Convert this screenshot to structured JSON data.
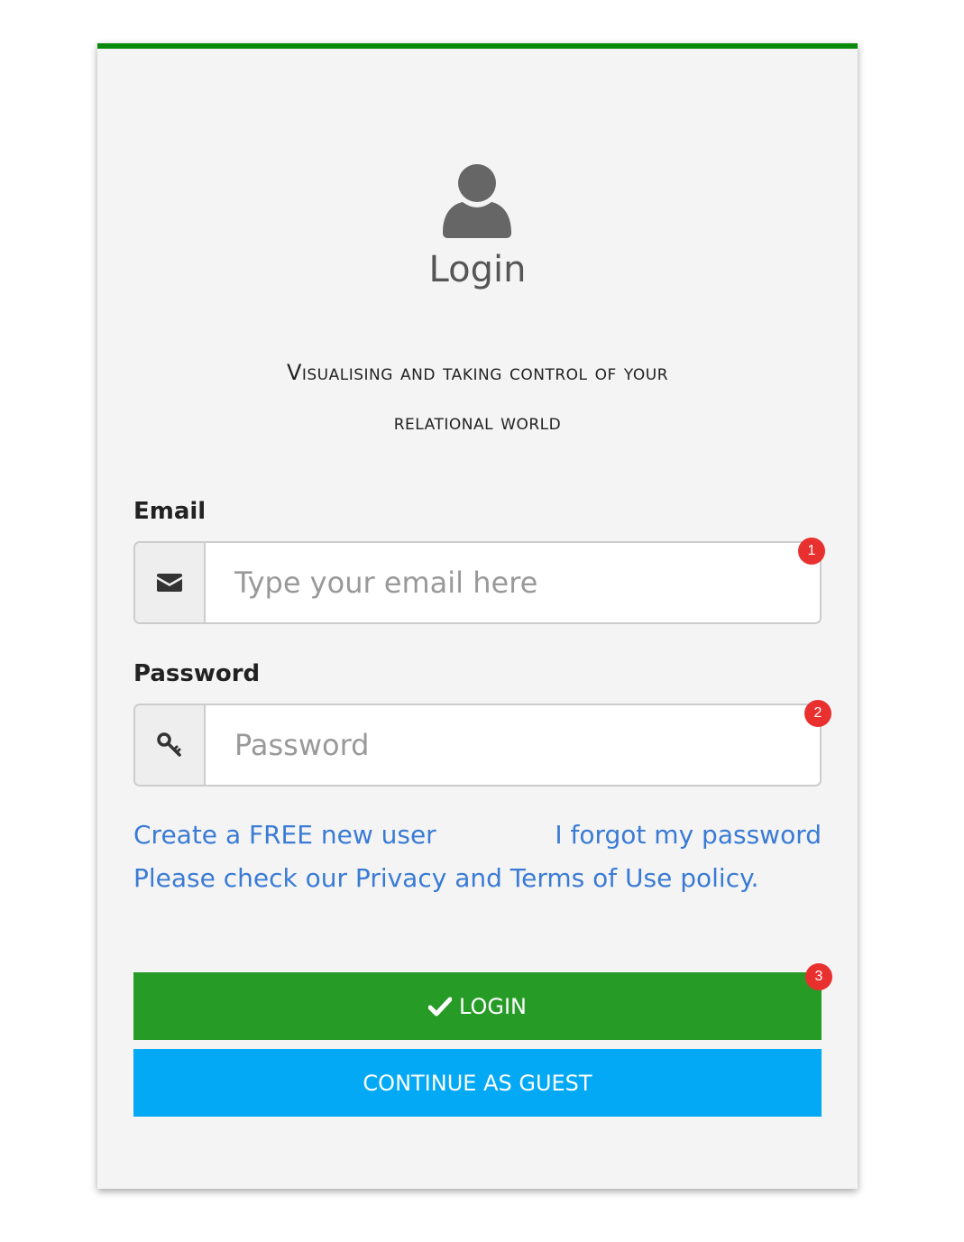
{
  "header": {
    "title": "Login",
    "tagline_line1": "Visualising and taking control of your",
    "tagline_line2": "relational world",
    "accent_color": "#0a8a0a"
  },
  "form": {
    "email_label": "Email",
    "email_placeholder": "Type your email here",
    "email_value": "",
    "email_icon": "envelope-icon",
    "email_badge": "1",
    "password_label": "Password",
    "password_placeholder": "Password",
    "password_value": "",
    "password_icon": "key-icon",
    "password_badge": "2"
  },
  "links": {
    "create_user": "Create a FREE new user",
    "forgot_password": "I forgot my password",
    "privacy": "Please check our Privacy and Terms of Use policy."
  },
  "buttons": {
    "login_label": "LOGIN",
    "login_icon": "check-icon",
    "login_badge": "3",
    "login_color": "#269b26",
    "guest_label": "CONTINUE AS GUEST",
    "guest_color": "#03a9f4"
  }
}
